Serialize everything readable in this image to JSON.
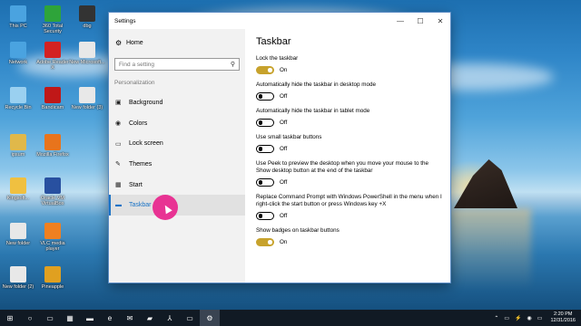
{
  "desktop": {
    "icons": [
      {
        "label": "This PC",
        "icon": "computer-icon",
        "color": "#4aa3e0"
      },
      {
        "label": "360 Total Security",
        "icon": "plus-shield-icon",
        "color": "#2ea43a"
      },
      {
        "label": "dbg",
        "icon": "folder-icon",
        "color": "#333333"
      },
      {
        "label": "Network",
        "icon": "network-icon",
        "color": "#4aa3e0"
      },
      {
        "label": "Adobe Reader X",
        "icon": "pdf-icon",
        "color": "#d32222"
      },
      {
        "label": "New Microsoft...",
        "icon": "document-icon",
        "color": "#e8e8e8"
      },
      {
        "label": "Recycle Bin",
        "icon": "recycle-bin-icon",
        "color": "#9ad0f0"
      },
      {
        "label": "Bandicam",
        "icon": "record-icon",
        "color": "#c01818"
      },
      {
        "label": "New folder (3)",
        "icon": "document-icon",
        "color": "#e8e8e8"
      },
      {
        "label": "ipsum",
        "icon": "user-icon",
        "color": "#e0b84a"
      },
      {
        "label": "Mozilla Firefox",
        "icon": "firefox-icon",
        "color": "#e8741c"
      },
      {
        "label": "Kingsoft...",
        "icon": "folder-icon",
        "color": "#f0c040"
      },
      {
        "label": "Oracle VM VirtualBox",
        "icon": "virtualbox-icon",
        "color": "#2850a0"
      },
      {
        "label": "New folder",
        "icon": "folder-icon",
        "color": "#e8e8e8"
      },
      {
        "label": "VLC media player",
        "icon": "vlc-icon",
        "color": "#f08020"
      },
      {
        "label": "New folder (2)",
        "icon": "document-icon",
        "color": "#e8e8e8"
      },
      {
        "label": "Pineapple",
        "icon": "pineapple-icon",
        "color": "#e0a020"
      }
    ]
  },
  "window": {
    "title": "Settings",
    "minimize_glyph": "—",
    "maximize_glyph": "☐",
    "close_glyph": "✕"
  },
  "sidebar": {
    "home_label": "Home",
    "home_icon": "⚙",
    "search_placeholder": "Find a setting",
    "search_icon": "⚲",
    "section_label": "Personalization",
    "items": [
      {
        "label": "Background",
        "icon": "background-icon",
        "glyph": "▣",
        "active": false
      },
      {
        "label": "Colors",
        "icon": "colors-icon",
        "glyph": "◉",
        "active": false
      },
      {
        "label": "Lock screen",
        "icon": "lock-screen-icon",
        "glyph": "▭",
        "active": false
      },
      {
        "label": "Themes",
        "icon": "themes-icon",
        "glyph": "✎",
        "active": false
      },
      {
        "label": "Start",
        "icon": "start-icon",
        "glyph": "▦",
        "active": false
      },
      {
        "label": "Taskbar",
        "icon": "taskbar-icon",
        "glyph": "▬",
        "active": true
      }
    ]
  },
  "content": {
    "heading": "Taskbar",
    "accent": "#c7a22c",
    "options": [
      {
        "label": "Lock the taskbar",
        "on": true,
        "state": "On"
      },
      {
        "label": "Automatically hide the taskbar in desktop mode",
        "on": false,
        "state": "Off"
      },
      {
        "label": "Automatically hide the taskbar in tablet mode",
        "on": false,
        "state": "Off"
      },
      {
        "label": "Use small taskbar buttons",
        "on": false,
        "state": "Off"
      },
      {
        "label": "Use Peek to preview the desktop when you move your mouse to the Show desktop button at the end of the taskbar",
        "on": false,
        "state": "Off"
      },
      {
        "label": "Replace Command Prompt with Windows PowerShell in the menu when I right-click the start button or press Windows key +X",
        "on": false,
        "state": "Off"
      },
      {
        "label": "Show badges on taskbar buttons",
        "on": true,
        "state": "On"
      }
    ]
  },
  "taskbar": {
    "buttons": [
      {
        "name": "start-icon",
        "glyph": "⊞"
      },
      {
        "name": "search-icon",
        "glyph": "○"
      },
      {
        "name": "task-view-icon",
        "glyph": "▭"
      },
      {
        "name": "store-icon",
        "glyph": "▦"
      },
      {
        "name": "explorer-icon",
        "glyph": "▬"
      },
      {
        "name": "edge-icon",
        "glyph": "e"
      },
      {
        "name": "mail-icon",
        "glyph": "✉"
      },
      {
        "name": "folder-icon",
        "glyph": "▰"
      },
      {
        "name": "acrobat-icon",
        "glyph": "⅄"
      },
      {
        "name": "media-icon",
        "glyph": "▭"
      },
      {
        "name": "settings-icon",
        "glyph": "⚙"
      }
    ],
    "tray": {
      "glyphs": [
        "⌃",
        "▭",
        "⚡",
        "◉",
        "▭"
      ],
      "time": "2:20 PM",
      "date": "12/31/2016"
    }
  }
}
